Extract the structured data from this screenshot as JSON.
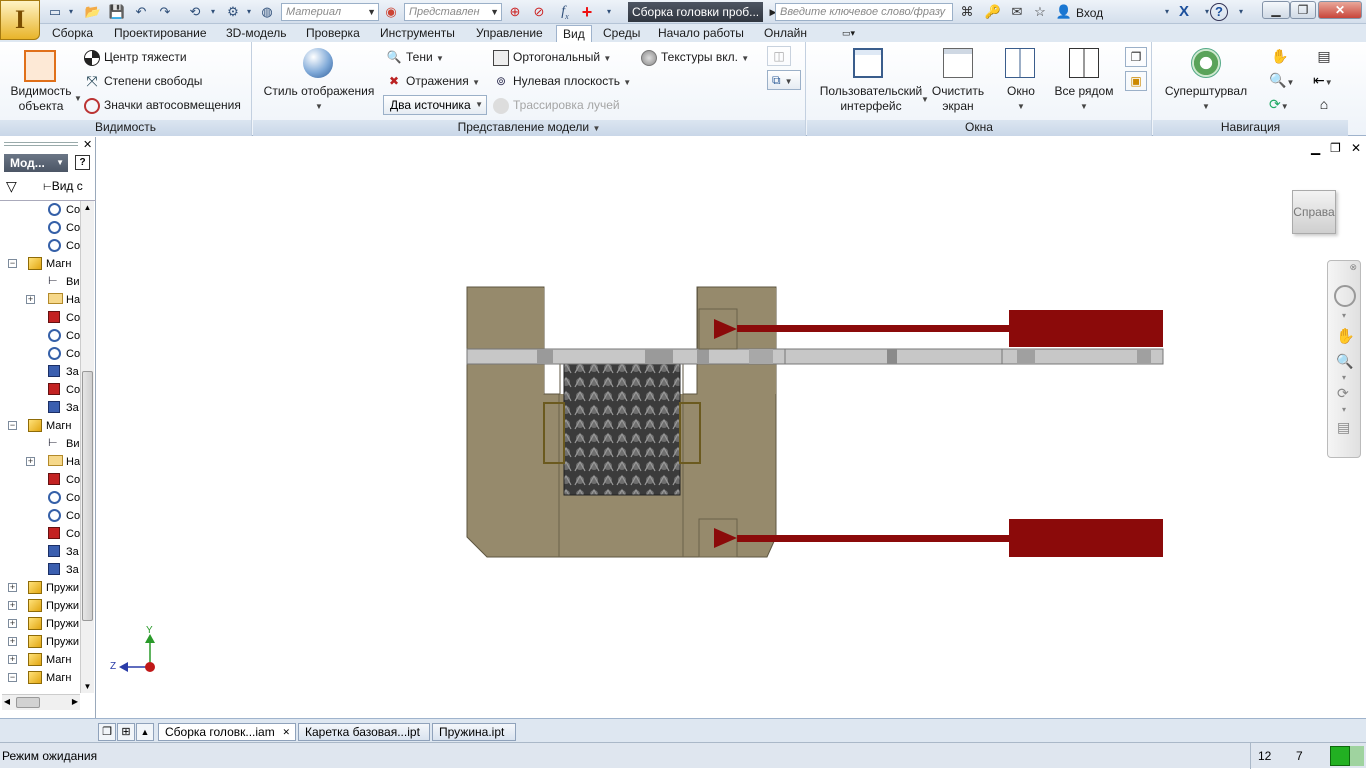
{
  "app": {
    "logo_letter": "I"
  },
  "quick_access": {
    "material_placeholder": "Материал",
    "representation_placeholder": "Представлен",
    "fx_label": "f",
    "fx_sub": "x",
    "doc_title": "Сборка головки проб...",
    "search_placeholder": "Введите ключевое слово/фразу",
    "signin_label": "Вход",
    "help_label": "?"
  },
  "menu_tabs": [
    "Сборка",
    "Проектирование",
    "3D-модель",
    "Проверка",
    "Инструменты",
    "Управление",
    "Вид",
    "Среды",
    "Начало работы",
    "Онлайн"
  ],
  "active_tab": "Вид",
  "ribbon": {
    "visibility": {
      "title": "Видимость",
      "object_visibility_line1": "Видимость",
      "object_visibility_line2": "объекта",
      "center_of_gravity": "Центр тяжести",
      "degrees_of_freedom": "Степени свободы",
      "auto_constraint_icons": "Значки автосовмещения"
    },
    "model_view": {
      "title": "Представление модели",
      "display_style": "Стиль отображения",
      "shadows": "Тени",
      "reflections": "Отражения",
      "lights": "Два источника",
      "orthographic": "Ортогональный",
      "ground_plane": "Нулевая плоскость",
      "ray_tracing": "Трассировка лучей",
      "textures": "Текстуры вкл."
    },
    "windows": {
      "title": "Окна",
      "user_interface_line1": "Пользовательский",
      "user_interface_line2": "интерфейс",
      "clean_screen_line1": "Очистить",
      "clean_screen_line2": "экран",
      "window": "Окно",
      "tile": "Все рядом"
    },
    "navigation": {
      "title": "Навигация",
      "steering_wheel": "Суперштурвал"
    }
  },
  "browser": {
    "header": "Мод...",
    "help_icon_label": "?",
    "view_label": "Вид с",
    "rows": [
      {
        "indent": 2,
        "icon": "constraint",
        "label": "Co",
        "pm": ""
      },
      {
        "indent": 2,
        "icon": "constraint",
        "label": "Co",
        "pm": ""
      },
      {
        "indent": 2,
        "icon": "constraint",
        "label": "Co",
        "pm": ""
      },
      {
        "indent": 1,
        "icon": "cube",
        "label": "Магн",
        "pm": "-"
      },
      {
        "indent": 2,
        "icon": "view",
        "label": "Ви",
        "pm": ""
      },
      {
        "indent": 2,
        "icon": "folder",
        "label": "На",
        "pm": "+"
      },
      {
        "indent": 2,
        "icon": "flush",
        "label": "Co",
        "pm": ""
      },
      {
        "indent": 2,
        "icon": "constraint",
        "label": "Co",
        "pm": ""
      },
      {
        "indent": 2,
        "icon": "constraint",
        "label": "Co",
        "pm": ""
      },
      {
        "indent": 2,
        "icon": "part",
        "label": "За",
        "pm": ""
      },
      {
        "indent": 2,
        "icon": "flush",
        "label": "Co",
        "pm": ""
      },
      {
        "indent": 2,
        "icon": "part",
        "label": "За",
        "pm": ""
      },
      {
        "indent": 1,
        "icon": "cube",
        "label": "Магн",
        "pm": "-"
      },
      {
        "indent": 2,
        "icon": "view",
        "label": "Ви",
        "pm": ""
      },
      {
        "indent": 2,
        "icon": "folder",
        "label": "На",
        "pm": "+"
      },
      {
        "indent": 2,
        "icon": "flush",
        "label": "Co",
        "pm": ""
      },
      {
        "indent": 2,
        "icon": "constraint",
        "label": "Co",
        "pm": ""
      },
      {
        "indent": 2,
        "icon": "constraint",
        "label": "Co",
        "pm": ""
      },
      {
        "indent": 2,
        "icon": "flush",
        "label": "Co",
        "pm": ""
      },
      {
        "indent": 2,
        "icon": "part",
        "label": "За",
        "pm": ""
      },
      {
        "indent": 2,
        "icon": "part",
        "label": "За",
        "pm": ""
      },
      {
        "indent": 1,
        "icon": "cube",
        "label": "Пружи",
        "pm": "+"
      },
      {
        "indent": 1,
        "icon": "cube",
        "label": "Пружи",
        "pm": "+"
      },
      {
        "indent": 1,
        "icon": "cube",
        "label": "Пружи",
        "pm": "+"
      },
      {
        "indent": 1,
        "icon": "cube",
        "label": "Пружи",
        "pm": "+"
      },
      {
        "indent": 1,
        "icon": "cube",
        "label": "Магн",
        "pm": "+"
      },
      {
        "indent": 1,
        "icon": "cube",
        "label": "Магн",
        "pm": "-"
      }
    ]
  },
  "viewcube": {
    "face_label": "Справа"
  },
  "axis": {
    "y_label": "Y",
    "z_label": "Z"
  },
  "doc_tabs": [
    {
      "label": "Сборка головк...iam",
      "active": true
    },
    {
      "label": "Каретка базовая...ipt",
      "active": false
    },
    {
      "label": "Пружина.ipt",
      "active": false
    }
  ],
  "status": {
    "text": "Режим ожидания",
    "count1": "12",
    "count2": "7"
  },
  "colors": {
    "body_tan": "#968a6c",
    "bar_dark_red": "#8b0a0a",
    "magnet_dark": "#3a3a3a",
    "rail_gray": "#c7c7c7",
    "status_green": "#22b022"
  }
}
